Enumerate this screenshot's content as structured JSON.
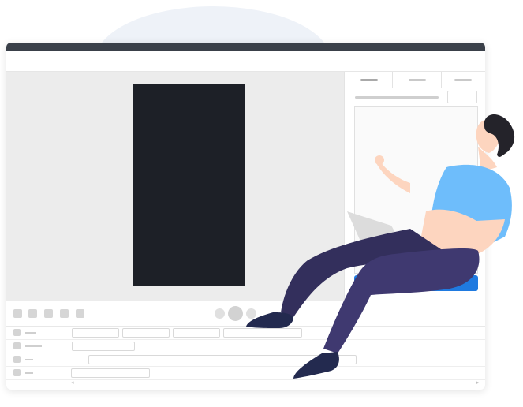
{
  "theme": {
    "titlebar_color": "#3a4049",
    "preview_color": "#1d2027",
    "accent_color": "#1f7ae0",
    "shirt_color": "#6ebdfb",
    "pants_color": "#3f3970",
    "skin_color": "#fdd5bf"
  },
  "icons": {
    "control_buttons": [
      "control-icon",
      "control-icon",
      "control-icon",
      "control-icon",
      "control-icon"
    ],
    "playback": [
      "previous-dot-icon",
      "play-dot-icon",
      "next-dot-icon"
    ]
  },
  "illustration": {
    "subject": "person-with-laptop"
  }
}
